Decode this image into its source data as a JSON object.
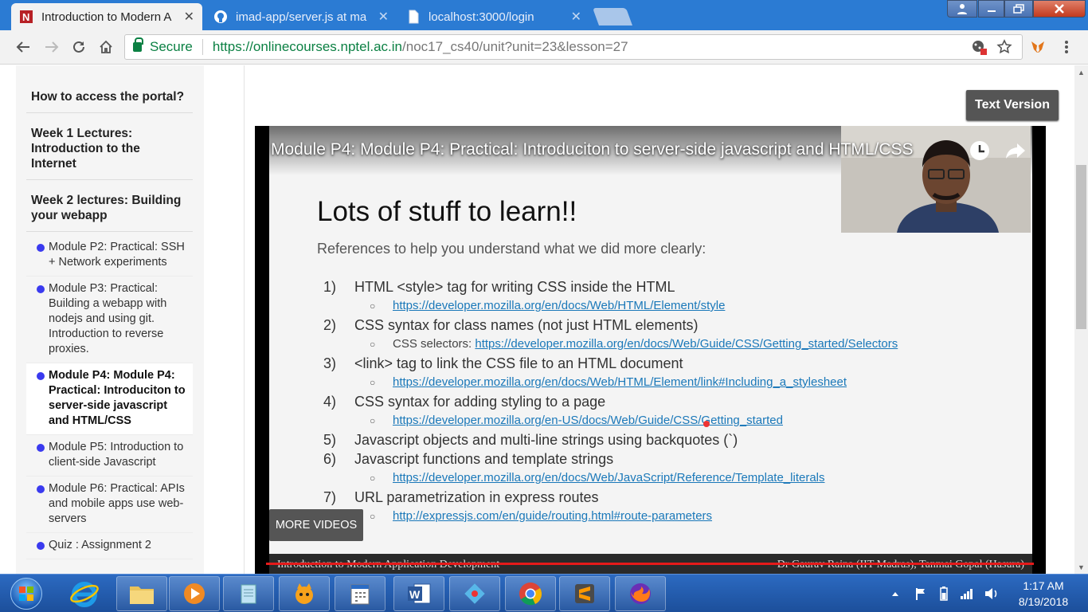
{
  "browser": {
    "tabs": [
      {
        "title": "Introduction to Modern A",
        "favicon": "nptel-icon"
      },
      {
        "title": "imad-app/server.js at ma",
        "favicon": "github-icon"
      },
      {
        "title": "localhost:3000/login",
        "favicon": "page-icon"
      }
    ],
    "close_glyph": "✕",
    "address": {
      "secure_label": "Secure",
      "url_scheme_host": "https://onlinecourses.nptel.ac.in",
      "url_path": "/noc17_cs40/unit?unit=23&lesson=27"
    }
  },
  "sidebar": {
    "sections": [
      {
        "title": "How to access the portal?"
      },
      {
        "title": "Week 1 Lectures: Introduction to the Internet"
      },
      {
        "title": "Week 2 lectures: Building your webapp"
      }
    ],
    "items": [
      {
        "label": "Module P2: Practical: SSH + Network experiments"
      },
      {
        "label": "Module P3: Practical: Building a webapp with nodejs and using git. Introduction to reverse proxies."
      },
      {
        "label": "Module P4: Module P4: Practical: Introduciton to server-side javascript and HTML/CSS"
      },
      {
        "label": "Module P5: Introduction to client-side Javascript"
      },
      {
        "label": "Module P6: Practical: APIs and mobile apps use web-servers"
      },
      {
        "label": "Quiz : Assignment 2"
      }
    ]
  },
  "main": {
    "text_version_label": "Text Version",
    "video": {
      "title": "Module P4: Module P4: Practical: Introduciton to server-side javascript and HTML/CSS",
      "more_videos_label": "MORE VIDEOS",
      "slide": {
        "heading": "Lots of stuff to learn!!",
        "subheading": "References to help you understand what we did more clearly:",
        "refs": [
          {
            "num": "1)",
            "text": "HTML <style> tag for writing CSS inside the HTML",
            "link_prefix": "",
            "link": "https://developer.mozilla.org/en/docs/Web/HTML/Element/style"
          },
          {
            "num": "2)",
            "text": "CSS syntax for class names (not just HTML elements)",
            "link_prefix": "CSS selectors: ",
            "link": "https://developer.mozilla.org/en/docs/Web/Guide/CSS/Getting_started/Selectors"
          },
          {
            "num": "3)",
            "text": "<link> tag to link the CSS file to an HTML document",
            "link_prefix": "",
            "link": "https://developer.mozilla.org/en/docs/Web/HTML/Element/link#Including_a_stylesheet"
          },
          {
            "num": "4)",
            "text": "CSS syntax for adding styling to a page",
            "link_prefix": "",
            "link": "https://developer.mozilla.org/en-US/docs/Web/Guide/CSS/Getting_started"
          },
          {
            "num": "5)",
            "text": "Javascript objects and multi-line strings using backquotes (`)",
            "link_prefix": "",
            "link": ""
          },
          {
            "num": "6)",
            "text": "Javascript functions and template strings",
            "link_prefix": "",
            "link": "https://developer.mozilla.org/en/docs/Web/JavaScript/Reference/Template_literals"
          },
          {
            "num": "7)",
            "text": "URL parametrization in express routes",
            "link_prefix": "",
            "link": "http://expressjs.com/en/guide/routing.html#route-parameters"
          }
        ],
        "footer_left": "Introduction to Modern Application Development",
        "footer_right": "Dr Gaurav Raina (IIT Madras), Tanmai Gopal (Hasura)"
      }
    }
  },
  "taskbar": {
    "apps": [
      "file-explorer-icon",
      "media-player-icon",
      "notepad-icon",
      "scratch-icon",
      "calendar-icon",
      "word-icon",
      "pinned-app-icon",
      "chrome-icon",
      "sublime-text-icon",
      "firefox-icon"
    ],
    "clock": {
      "time": "1:17 AM",
      "date": "8/19/2018"
    }
  },
  "colors": {
    "accent_link": "#1a78b9",
    "secure_green": "#0b8043",
    "progress_red": "#e51a1a"
  }
}
